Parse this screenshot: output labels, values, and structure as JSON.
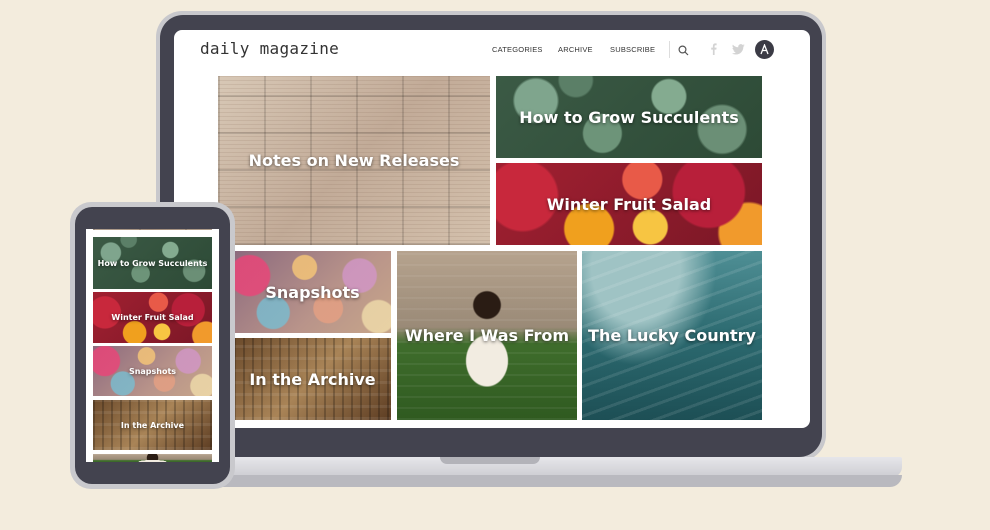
{
  "site": {
    "logo": "daily magazine",
    "nav": {
      "categories": "CATEGORIES",
      "archive": "ARCHIVE",
      "subscribe": "SUBSCRIBE"
    }
  },
  "tiles": {
    "notes": "Notes on New Releases",
    "succulents": "How to Grow Succulents",
    "fruit": "Winter Fruit Salad",
    "snapshots": "Snapshots",
    "archive": "In the Archive",
    "where": "Where I Was From",
    "lucky": "The Lucky Country"
  },
  "icons": {
    "search": "search-icon",
    "facebook": "facebook-icon",
    "twitter": "twitter-icon",
    "brand": "brand-a-icon"
  },
  "colors": {
    "background": "#f3ecdd",
    "device_dark": "#43434f",
    "text": "#333333"
  }
}
